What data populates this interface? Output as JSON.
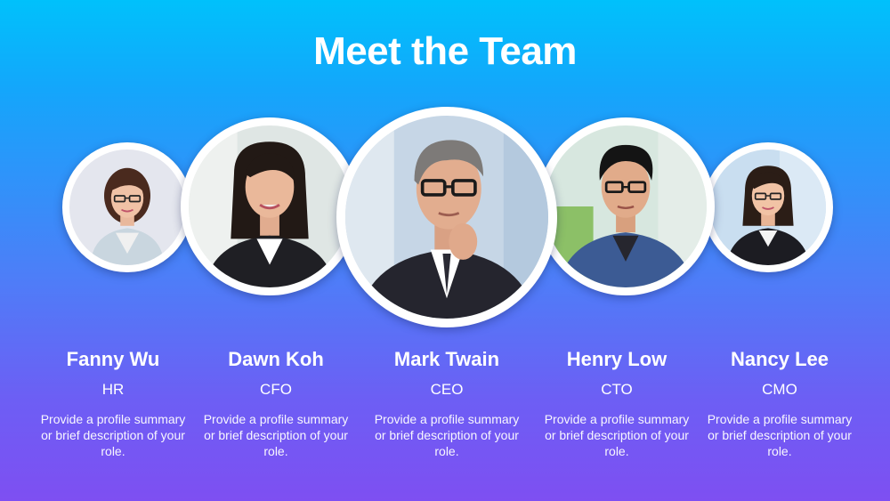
{
  "title": "Meet the Team",
  "colors": {
    "gradient_top": "#00c1fb",
    "gradient_bottom": "#7e4ff2",
    "text": "#ffffff",
    "frame": "#ffffff"
  },
  "team": [
    {
      "name": "Fanny Wu",
      "role": "HR",
      "description": "Provide a profile summary or brief description of your role.",
      "photo": "woman-headshot-photo"
    },
    {
      "name": "Dawn Koh",
      "role": "CFO",
      "description": "Provide a profile summary or brief description of your role.",
      "photo": "woman-headshot-photo"
    },
    {
      "name": "Mark Twain",
      "role": "CEO",
      "description": "Provide a profile summary or brief description of your role.",
      "photo": "man-headshot-photo"
    },
    {
      "name": "Henry Low",
      "role": "CTO",
      "description": "Provide a profile summary or brief description of your role.",
      "photo": "man-headshot-photo"
    },
    {
      "name": "Nancy Lee",
      "role": "CMO",
      "description": "Provide a profile summary or brief description of your role.",
      "photo": "woman-headshot-photo"
    }
  ]
}
